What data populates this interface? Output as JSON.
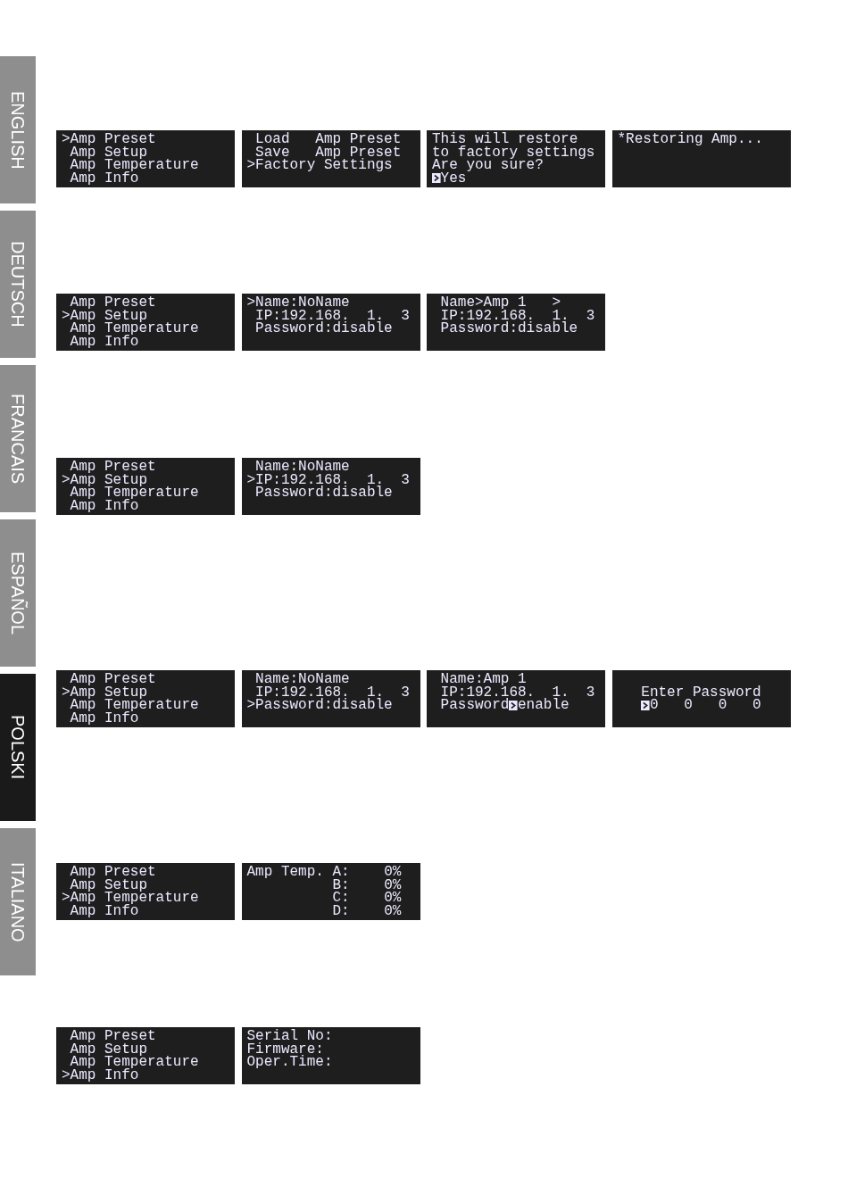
{
  "language_tabs": [
    {
      "label": "ENGLISH",
      "selected": false
    },
    {
      "label": "DEUTSCH",
      "selected": false
    },
    {
      "label": "FRANCAIS",
      "selected": false
    },
    {
      "label": "ESPAÑOL",
      "selected": false
    },
    {
      "label": "POLSKI",
      "selected": true
    },
    {
      "label": "ITALIANO",
      "selected": false
    }
  ],
  "screen_rows": [
    {
      "screens": [
        {
          "kind": "menu",
          "lines": [
            {
              "cursor": ">",
              "text": "Amp Preset"
            },
            {
              "text": "Amp Setup"
            },
            {
              "text": "Amp Temperature"
            },
            {
              "text": "Amp Info"
            }
          ]
        },
        {
          "kind": "menu",
          "lines": [
            {
              "text": "Load   Amp Preset"
            },
            {
              "text": "Save   Amp Preset"
            },
            {
              "cursor": ">",
              "text": "Factory Settings"
            }
          ]
        },
        {
          "kind": "text",
          "lines": [
            {
              "text": "This will restore"
            },
            {
              "text": "to factory settings"
            },
            {
              "text": "Are you sure?"
            },
            {
              "block_cursor": true,
              "text_after": "Yes"
            }
          ]
        },
        {
          "kind": "text",
          "lines": [
            {
              "text": "*Restoring Amp..."
            }
          ]
        }
      ]
    },
    {
      "screens": [
        {
          "kind": "menu",
          "lines": [
            {
              "text": "Amp Preset"
            },
            {
              "cursor": ">",
              "text": "Amp Setup"
            },
            {
              "text": "Amp Temperature"
            },
            {
              "text": "Amp Info"
            }
          ]
        },
        {
          "kind": "menu",
          "lines": [
            {
              "cursor": ">",
              "text": "Name:NoName"
            },
            {
              "text": "IP:192.168.  1.  3"
            },
            {
              "text": "Password:disable"
            }
          ]
        },
        {
          "kind": "editor",
          "lines": [
            {
              "text": "Name>Amp 1   >"
            },
            {
              "text": "IP:192.168.  1.  3"
            },
            {
              "text": "Password:disable"
            }
          ]
        }
      ]
    },
    {
      "screens": [
        {
          "kind": "menu",
          "lines": [
            {
              "text": "Amp Preset"
            },
            {
              "cursor": ">",
              "text": "Amp Setup"
            },
            {
              "text": "Amp Temperature"
            },
            {
              "text": "Amp Info"
            }
          ]
        },
        {
          "kind": "menu",
          "lines": [
            {
              "text": "Name:NoName"
            },
            {
              "cursor": ">",
              "text": "IP:192.168.  1.  3"
            },
            {
              "text": "Password:disable"
            }
          ]
        }
      ]
    },
    {
      "screens": [
        {
          "kind": "menu",
          "lines": [
            {
              "text": "Amp Preset"
            },
            {
              "cursor": ">",
              "text": "Amp Setup"
            },
            {
              "text": "Amp Temperature"
            },
            {
              "text": "Amp Info"
            }
          ]
        },
        {
          "kind": "menu",
          "lines": [
            {
              "text": "Name:NoName"
            },
            {
              "text": "IP:192.168.  1.  3"
            },
            {
              "cursor": ">",
              "text": "Password:disable"
            }
          ]
        },
        {
          "kind": "editor",
          "lines": [
            {
              "text": "Name:Amp 1"
            },
            {
              "text": "IP:192.168.  1.  3"
            },
            {
              "text": "Password",
              "block_cursor": true,
              "text_after": "enable"
            }
          ]
        },
        {
          "kind": "entry",
          "prompt": "Enter Password",
          "digits": [
            {
              "value": "0",
              "selected": true
            },
            {
              "value": "0",
              "selected": false
            },
            {
              "value": "0",
              "selected": false
            },
            {
              "value": "0",
              "selected": false
            }
          ]
        }
      ]
    },
    {
      "screens": [
        {
          "kind": "menu",
          "lines": [
            {
              "text": "Amp Preset"
            },
            {
              "text": "Amp Setup"
            },
            {
              "cursor": ">",
              "text": "Amp Temperature"
            },
            {
              "text": "Amp Info"
            }
          ]
        },
        {
          "kind": "temperature",
          "title": "Amp Temp.",
          "channels": [
            {
              "label": "A:",
              "value": "0%"
            },
            {
              "label": "B:",
              "value": "0%"
            },
            {
              "label": "C:",
              "value": "0%"
            },
            {
              "label": "D:",
              "value": "0%"
            }
          ]
        }
      ]
    },
    {
      "screens": [
        {
          "kind": "menu",
          "lines": [
            {
              "text": "Amp Preset"
            },
            {
              "text": "Amp Setup"
            },
            {
              "text": "Amp Temperature"
            },
            {
              "cursor": ">",
              "text": "Amp Info"
            }
          ]
        },
        {
          "kind": "text",
          "lines": [
            {
              "text": "Serial No:"
            },
            {
              "text": "Firmware:"
            },
            {
              "text": "Oper.Time:"
            }
          ]
        }
      ]
    }
  ]
}
